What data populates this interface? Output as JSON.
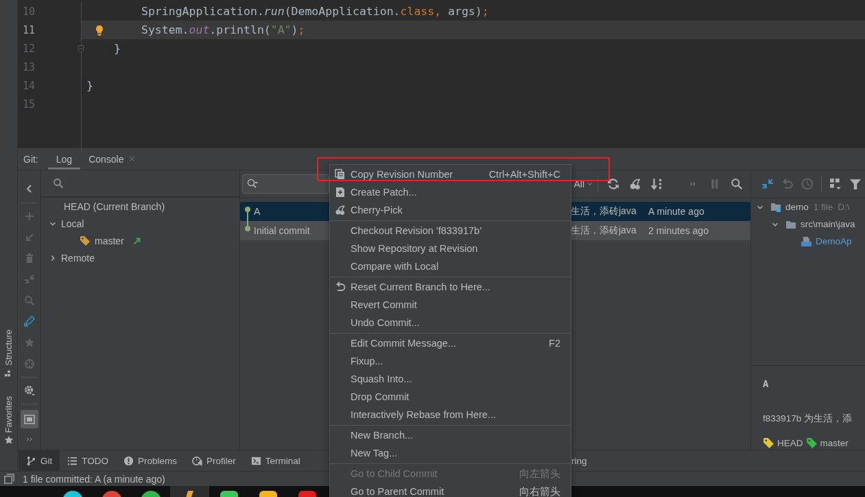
{
  "stripe": {
    "labels": [
      "Structure",
      "Favorites"
    ]
  },
  "editor": {
    "lines": [
      {
        "number": "10",
        "current": false,
        "bulb": false,
        "fold": false,
        "tokens": [
          {
            "text": "SpringApplication.",
            "kind": "plain"
          },
          {
            "text": "run",
            "kind": "italic"
          },
          {
            "text": "(DemoApplication.",
            "kind": "plain"
          },
          {
            "text": "class, ",
            "kind": "keyword"
          },
          {
            "text": "args)",
            "kind": "plain"
          },
          {
            "text": ";",
            "kind": "keyword"
          }
        ]
      },
      {
        "number": "11",
        "current": true,
        "bulb": true,
        "fold": false,
        "tokens": [
          {
            "text": "System.",
            "kind": "plain"
          },
          {
            "text": "out",
            "kind": "static"
          },
          {
            "text": ".println(",
            "kind": "plain"
          },
          {
            "text": "\"A\"",
            "kind": "string"
          },
          {
            "text": ")",
            "kind": "plain"
          },
          {
            "text": ";",
            "kind": "keyword"
          }
        ]
      },
      {
        "number": "12",
        "current": false,
        "bulb": false,
        "fold": true,
        "tokens": [
          {
            "text": "}",
            "kind": "plain"
          }
        ]
      },
      {
        "number": "13",
        "current": false,
        "bulb": false,
        "fold": false
      },
      {
        "number": "14",
        "current": false,
        "bulb": false,
        "fold": false,
        "tokens": [
          {
            "text": "}",
            "kind": "plain"
          }
        ]
      },
      {
        "number": "15",
        "current": false,
        "bulb": false,
        "fold": false
      }
    ]
  },
  "git": {
    "title": "Git:",
    "tabs": [
      {
        "label": "Log",
        "selected": true,
        "closable": false
      },
      {
        "label": "Console",
        "selected": false,
        "closable": true
      }
    ],
    "branches": [
      {
        "label": "HEAD (Current Branch)",
        "kind": "ref"
      },
      {
        "label": "Local",
        "kind": "group",
        "expanded": true,
        "children": [
          {
            "label": "master",
            "kind": "branch"
          }
        ]
      },
      {
        "label": "Remote",
        "kind": "group",
        "expanded": false
      }
    ],
    "log": {
      "filter": "All",
      "commits": [
        {
          "subject": "A",
          "author": "生活，添砖java",
          "date": "A minute ago",
          "selected": true,
          "hovered": false
        },
        {
          "subject": "Initial commit",
          "author": "生活，添砖java",
          "date": "2 minutes ago",
          "selected": false,
          "hovered": true
        }
      ]
    },
    "details": {
      "changes": [
        {
          "label": "demo",
          "kind": "module",
          "info": "1 file",
          "path": "D:\\",
          "expanded": true,
          "children": [
            {
              "label": "src\\main\\java",
              "kind": "folder",
              "expanded": true,
              "children": [
                {
                  "label": "DemoAp",
                  "kind": "java"
                }
              ]
            }
          ]
        }
      ],
      "subject": "A",
      "hash_line": "f833917b 为生活，添",
      "refs": [
        {
          "label": "HEAD",
          "color": "#e5c532"
        },
        {
          "label": "master",
          "color": "#3cb54a"
        }
      ]
    }
  },
  "context_menu": {
    "groups": [
      {
        "items": [
          {
            "label": "Copy Revision Number",
            "shortcut": "Ctrl+Alt+Shift+C",
            "disabled": false
          },
          {
            "label": "Create Patch...",
            "disabled": false
          },
          {
            "label": "Cherry-Pick",
            "disabled": false
          }
        ]
      },
      {
        "items": [
          {
            "label": "Checkout Revision 'f833917b'",
            "disabled": false
          },
          {
            "label": "Show Repository at Revision",
            "disabled": false
          },
          {
            "label": "Compare with Local",
            "disabled": false
          }
        ]
      },
      {
        "items": [
          {
            "label": "Reset Current Branch to Here...",
            "disabled": false
          },
          {
            "label": "Revert Commit",
            "disabled": false
          },
          {
            "label": "Undo Commit...",
            "disabled": false
          }
        ]
      },
      {
        "items": [
          {
            "label": "Edit Commit Message...",
            "shortcut": "F2",
            "disabled": false
          },
          {
            "label": "Fixup...",
            "disabled": false
          },
          {
            "label": "Squash Into...",
            "disabled": false
          },
          {
            "label": "Drop Commit",
            "disabled": false
          },
          {
            "label": "Interactively Rebase from Here...",
            "disabled": false
          }
        ]
      },
      {
        "items": [
          {
            "label": "New Branch...",
            "disabled": false
          },
          {
            "label": "New Tag...",
            "disabled": false
          }
        ]
      },
      {
        "items": [
          {
            "label": "Go to Child Commit",
            "shortcut": "向左箭头",
            "disabled": true
          },
          {
            "label": "Go to Parent Commit",
            "shortcut": "向右箭头",
            "disabled": false
          }
        ]
      }
    ]
  },
  "tool_tabs": [
    {
      "label": "Git",
      "kind": "branch",
      "selected": true
    },
    {
      "label": "TODO",
      "kind": "list",
      "selected": false
    },
    {
      "label": "Problems",
      "kind": "problems",
      "selected": false
    },
    {
      "label": "Profiler",
      "kind": "profiler",
      "selected": false
    },
    {
      "label": "Terminal",
      "kind": "terminal",
      "selected": false
    },
    {
      "label": "ring",
      "kind": "plain",
      "selected": false
    }
  ],
  "status_bar": {
    "text": "1 file committed: A (a minute ago)"
  }
}
